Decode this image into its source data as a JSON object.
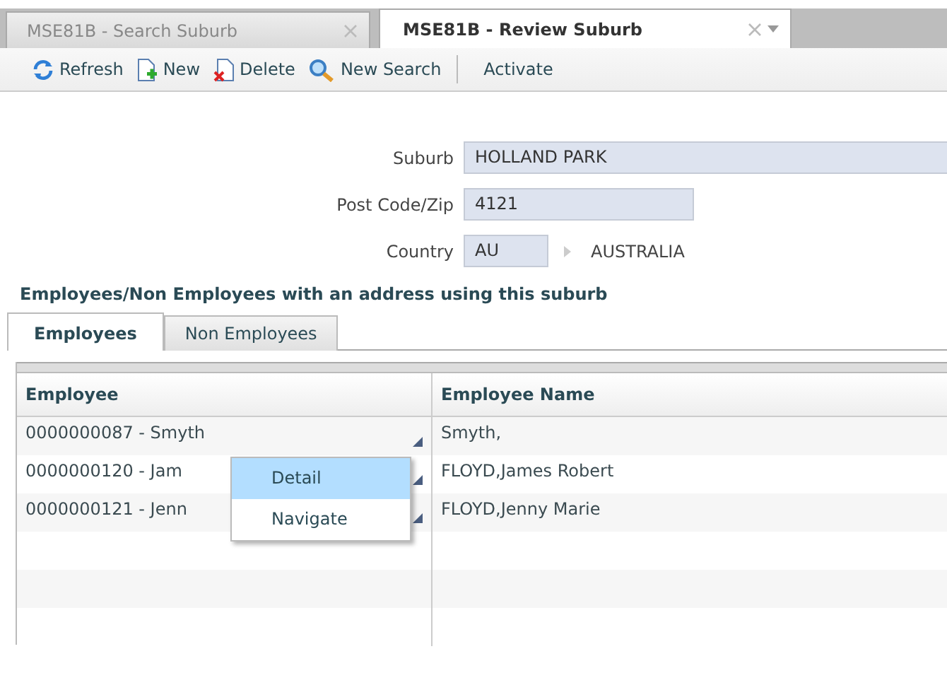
{
  "tabs": [
    {
      "label": "MSE81B - Search Suburb",
      "selected": false,
      "dropdown": false
    },
    {
      "label": "MSE81B - Review Suburb",
      "selected": true,
      "dropdown": true
    }
  ],
  "toolbar": [
    {
      "kind": "refresh",
      "label": "Refresh"
    },
    {
      "kind": "new",
      "label": "New"
    },
    {
      "kind": "delete",
      "label": "Delete"
    },
    {
      "kind": "search",
      "label": "New Search"
    },
    {
      "kind": "separator"
    },
    {
      "kind": "plain",
      "label": "Activate"
    }
  ],
  "form": {
    "suburb": {
      "label": "Suburb",
      "value": "HOLLAND PARK"
    },
    "postcode": {
      "label": "Post Code/Zip",
      "value": "4121"
    },
    "country": {
      "label": "Country",
      "value": "AU",
      "description": "AUSTRALIA"
    }
  },
  "section_title": "Employees/Non Employees with an address using this suburb",
  "subtabs": [
    {
      "label": "Employees",
      "selected": true
    },
    {
      "label": "Non Employees",
      "selected": false
    }
  ],
  "table": {
    "columns": [
      "Employee",
      "Employee Name"
    ],
    "rows": [
      [
        "0000000087 - Smyth",
        "Smyth,"
      ],
      [
        "0000000120 - Jam",
        "FLOYD,James Robert"
      ],
      [
        "0000000121 - Jenn",
        "FLOYD,Jenny Marie"
      ]
    ]
  },
  "context_menu": {
    "items": [
      {
        "label": "Detail",
        "selected": true
      },
      {
        "label": "Navigate",
        "selected": false
      }
    ]
  }
}
